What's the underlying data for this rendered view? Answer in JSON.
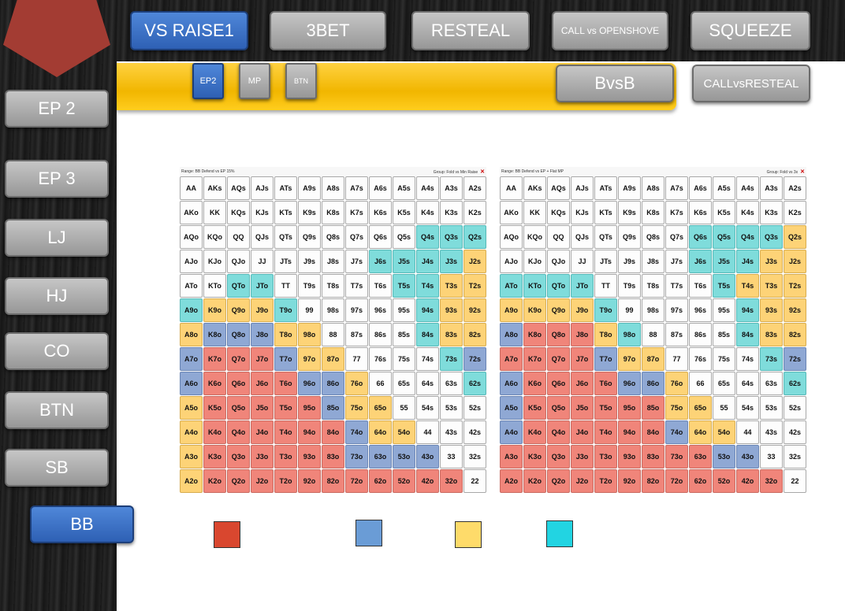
{
  "sidebar": {
    "items": [
      {
        "label": "EP 2",
        "active": false
      },
      {
        "label": "EP 3",
        "active": false
      },
      {
        "label": "LJ",
        "active": false
      },
      {
        "label": "HJ",
        "active": false
      },
      {
        "label": "CO",
        "active": false
      },
      {
        "label": "BTN",
        "active": false
      },
      {
        "label": "SB",
        "active": false
      },
      {
        "label": "BB",
        "active": true
      }
    ]
  },
  "top_tabs": [
    {
      "label": "VS RAISE1",
      "active": true
    },
    {
      "label": "3BET",
      "active": false
    },
    {
      "label": "RESTEAL",
      "active": false
    },
    {
      "label": "CALL vs OPENSHOVE",
      "active": false
    },
    {
      "label": "SQUEEZE",
      "active": false
    }
  ],
  "sub_tabs": [
    {
      "label": "EP2",
      "active": true
    },
    {
      "label": "MP",
      "active": false
    },
    {
      "label": "BTN",
      "active": false
    }
  ],
  "extra_buttons": {
    "bvsb": "BvsB",
    "call_vs_resteal": "CALLvsRESTEAL"
  },
  "colors": {
    "accent_blue": "#3a70c8",
    "toolbar_yellow": "#f5bf10",
    "range_red": "#f0857a",
    "range_blue": "#8fa8d4",
    "range_yellow": "#fdd377",
    "range_cyan": "#7fdcdb"
  },
  "hands": [
    [
      "AA",
      "AKs",
      "AQs",
      "AJs",
      "ATs",
      "A9s",
      "A8s",
      "A7s",
      "A6s",
      "A5s",
      "A4s",
      "A3s",
      "A2s"
    ],
    [
      "AKo",
      "KK",
      "KQs",
      "KJs",
      "KTs",
      "K9s",
      "K8s",
      "K7s",
      "K6s",
      "K5s",
      "K4s",
      "K3s",
      "K2s"
    ],
    [
      "AQo",
      "KQo",
      "QQ",
      "QJs",
      "QTs",
      "Q9s",
      "Q8s",
      "Q7s",
      "Q6s",
      "Q5s",
      "Q4s",
      "Q3s",
      "Q2s"
    ],
    [
      "AJo",
      "KJo",
      "QJo",
      "JJ",
      "JTs",
      "J9s",
      "J8s",
      "J7s",
      "J6s",
      "J5s",
      "J4s",
      "J3s",
      "J2s"
    ],
    [
      "ATo",
      "KTo",
      "QTo",
      "JTo",
      "TT",
      "T9s",
      "T8s",
      "T7s",
      "T6s",
      "T5s",
      "T4s",
      "T3s",
      "T2s"
    ],
    [
      "A9o",
      "K9o",
      "Q9o",
      "J9o",
      "T9o",
      "99",
      "98s",
      "97s",
      "96s",
      "95s",
      "94s",
      "93s",
      "92s"
    ],
    [
      "A8o",
      "K8o",
      "Q8o",
      "J8o",
      "T8o",
      "98o",
      "88",
      "87s",
      "86s",
      "85s",
      "84s",
      "83s",
      "82s"
    ],
    [
      "A7o",
      "K7o",
      "Q7o",
      "J7o",
      "T7o",
      "97o",
      "87o",
      "77",
      "76s",
      "75s",
      "74s",
      "73s",
      "72s"
    ],
    [
      "A6o",
      "K6o",
      "Q6o",
      "J6o",
      "T6o",
      "96o",
      "86o",
      "76o",
      "66",
      "65s",
      "64s",
      "63s",
      "62s"
    ],
    [
      "A5o",
      "K5o",
      "Q5o",
      "J5o",
      "T5o",
      "95o",
      "85o",
      "75o",
      "65o",
      "55",
      "54s",
      "53s",
      "52s"
    ],
    [
      "A4o",
      "K4o",
      "Q4o",
      "J4o",
      "T4o",
      "94o",
      "84o",
      "74o",
      "64o",
      "54o",
      "44",
      "43s",
      "42s"
    ],
    [
      "A3o",
      "K3o",
      "Q3o",
      "J3o",
      "T3o",
      "93o",
      "83o",
      "73o",
      "63o",
      "53o",
      "43o",
      "33",
      "32s"
    ],
    [
      "A2o",
      "K2o",
      "Q2o",
      "J2o",
      "T2o",
      "92o",
      "82o",
      "72o",
      "62o",
      "52o",
      "42o",
      "32o",
      "22"
    ]
  ],
  "charts": [
    {
      "range_text": "Range: BB Defend vs EP 15%",
      "group_text": "Group: Fold vs Min Raise",
      "colors": [
        "WWWWWWWWWWWWW",
        "WWWWWWWWWWWWW",
        "WWWWWWWWWWCCC",
        "WWWWWWWWCCCCY",
        "WWCCWWWWWCCYY",
        "CYYYCWWWWWCYY",
        "YBBBYYWWWWCYY",
        "BRRRBYYWWWWCB",
        "BRRRRBBYWWWWC",
        "YRRRRRBYYWWWW",
        "YRRRRRRBYYWWW",
        "YRRRRRRBBBBWW",
        "YRRRRRRRRRRRW"
      ]
    },
    {
      "range_text": "Range: BB Defend vs EP + Flat MP",
      "group_text": "Group: Fold vs 3x",
      "colors": [
        "WWWWWWWWWWWWW",
        "WWWWWWWWWWWWW",
        "WWWWWWWWCCCCY",
        "WWWWWWWWCCCYY",
        "CCCCWWWWWCYYY",
        "YYYYCWWWWWCYY",
        "BRRRYCWWWWCYY",
        "RRRRBYYWWWWCB",
        "BRRRRBBYWWWWC",
        "BRRRRRRYYWWWW",
        "BRRRRRRBYYWWW",
        "RRRRRRRRRBBWW",
        "RRRRRRRRRRRRW"
      ]
    }
  ],
  "legend": [
    {
      "color": "#d9472f",
      "name": "red-swatch"
    },
    {
      "color": "#6a9cd6",
      "name": "blue-swatch"
    },
    {
      "color": "#fedb6a",
      "name": "yellow-swatch"
    },
    {
      "color": "#22d4e2",
      "name": "cyan-swatch"
    }
  ]
}
